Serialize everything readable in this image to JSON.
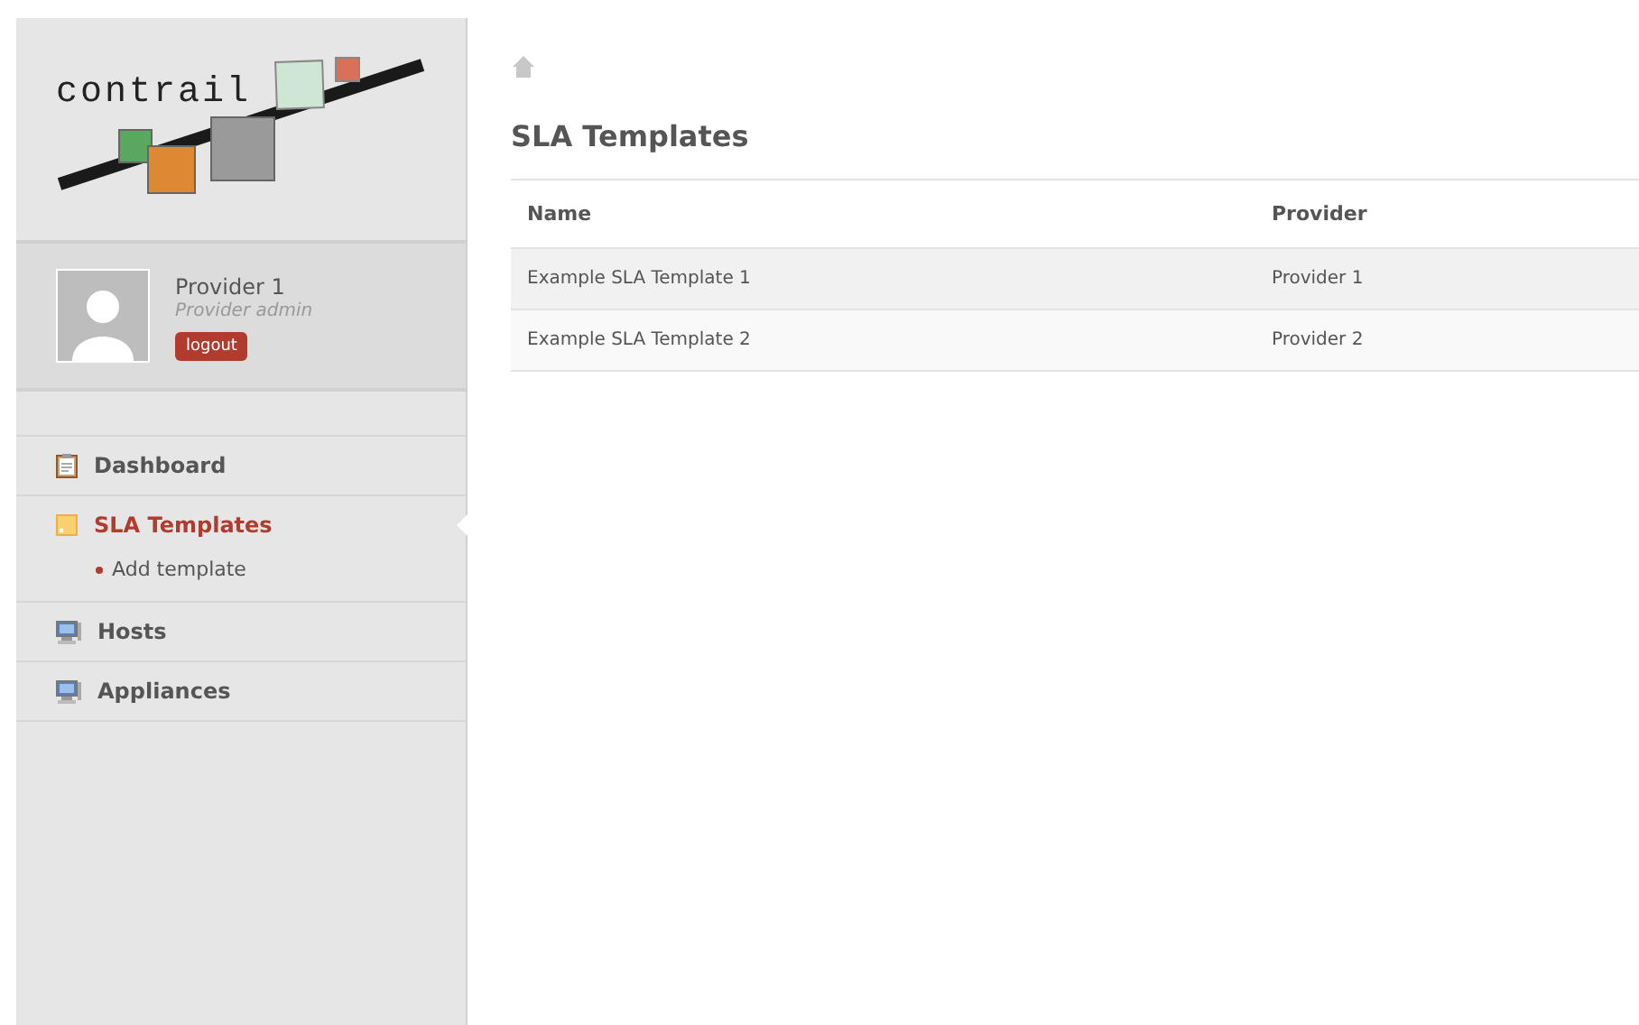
{
  "logo": {
    "text": "contrail"
  },
  "user": {
    "name": "Provider 1",
    "role": "Provider admin",
    "logout": "logout"
  },
  "nav": [
    {
      "label": "Dashboard",
      "kind": "clipboard",
      "selected": false
    },
    {
      "label": "SLA Templates",
      "kind": "feed",
      "selected": true,
      "children": [
        {
          "label": "Add template"
        }
      ]
    },
    {
      "label": "Hosts",
      "kind": "monitor",
      "selected": false
    },
    {
      "label": "Appliances",
      "kind": "monitor",
      "selected": false
    }
  ],
  "page": {
    "title": "SLA Templates"
  },
  "table": {
    "columns": [
      "Name",
      "Provider"
    ],
    "rows": [
      [
        "Example SLA Template 1",
        "Provider 1"
      ],
      [
        "Example SLA Template 2",
        "Provider 2"
      ]
    ]
  }
}
